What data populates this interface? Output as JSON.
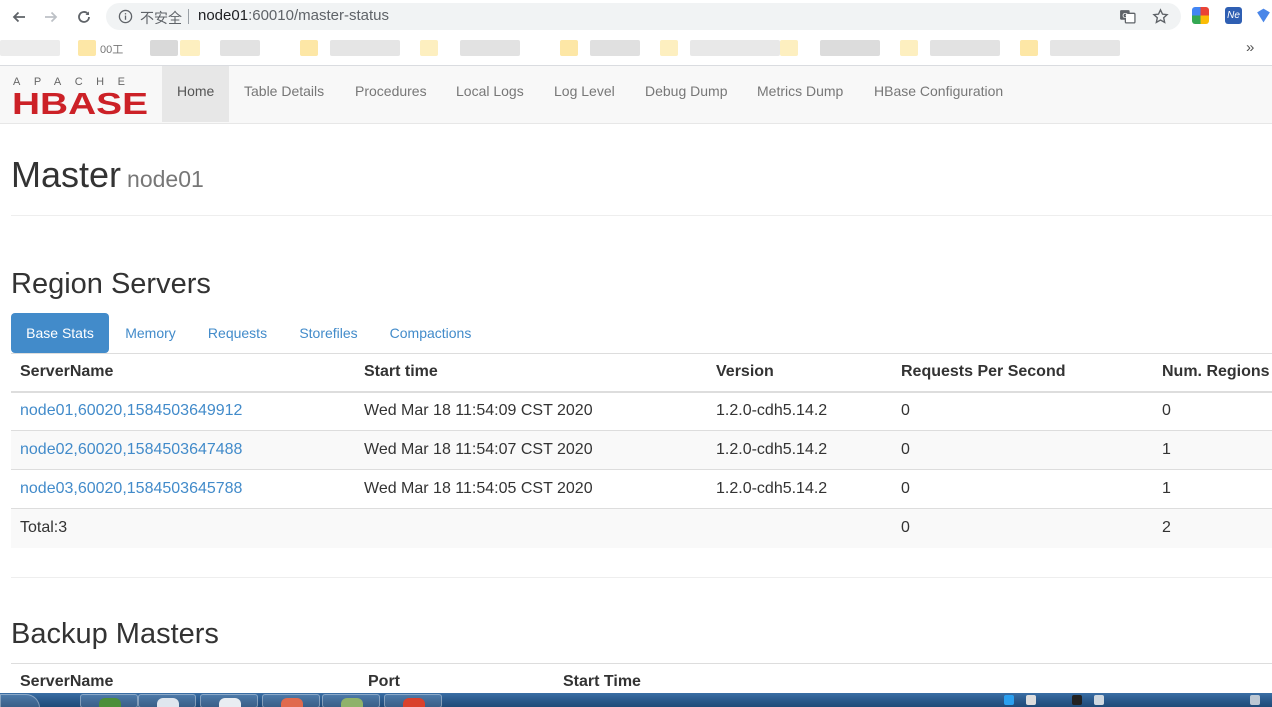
{
  "browser": {
    "security_text": "不安全",
    "url_host": "node01",
    "url_path": ":60010/master-status",
    "bookmark_partial": "00工"
  },
  "brand": {
    "logo_top": "APACHE",
    "logo_bottom": "HBASE"
  },
  "nav": {
    "items": [
      "Home",
      "Table Details",
      "Procedures",
      "Local Logs",
      "Log Level",
      "Debug Dump",
      "Metrics Dump",
      "HBase Configuration"
    ],
    "active": "Home"
  },
  "page": {
    "title": "Master",
    "subtitle": "node01"
  },
  "region_servers": {
    "title": "Region Servers",
    "tabs": [
      "Base Stats",
      "Memory",
      "Requests",
      "Storefiles",
      "Compactions"
    ],
    "active_tab": "Base Stats",
    "columns": [
      "ServerName",
      "Start time",
      "Version",
      "Requests Per Second",
      "Num. Regions"
    ],
    "rows": [
      [
        "node01,60020,1584503649912",
        "Wed Mar 18 11:54:09 CST 2020",
        "1.2.0-cdh5.14.2",
        "0",
        "0"
      ],
      [
        "node02,60020,1584503647488",
        "Wed Mar 18 11:54:07 CST 2020",
        "1.2.0-cdh5.14.2",
        "0",
        "1"
      ],
      [
        "node03,60020,1584503645788",
        "Wed Mar 18 11:54:05 CST 2020",
        "1.2.0-cdh5.14.2",
        "0",
        "1"
      ]
    ],
    "total": {
      "label": "Total:3",
      "requests": "0",
      "regions": "2"
    }
  },
  "backup_masters": {
    "title": "Backup Masters",
    "columns": [
      "ServerName",
      "Port",
      "Start Time"
    ]
  },
  "colors": {
    "link": "#428bca",
    "logo_red": "#cc2127",
    "navbar_bg": "#f8f8f8",
    "taskbar": "#2b5a8c"
  }
}
